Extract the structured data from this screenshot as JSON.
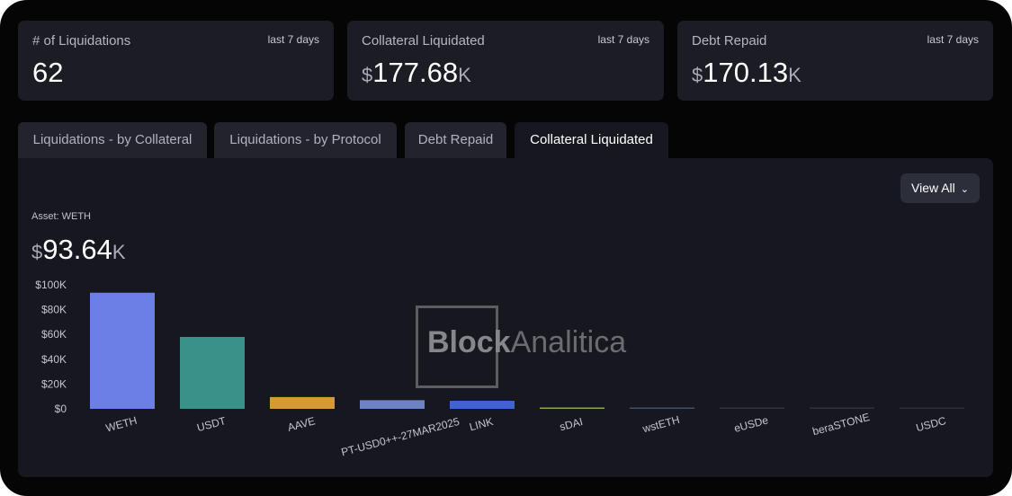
{
  "cards": [
    {
      "label": "# of Liquidations",
      "period": "last 7 days",
      "currency": "",
      "number": "62",
      "suffix": ""
    },
    {
      "label": "Collateral Liquidated",
      "period": "last 7 days",
      "currency": "$",
      "number": "177.68",
      "suffix": "K"
    },
    {
      "label": "Debt Repaid",
      "period": "last 7 days",
      "currency": "$",
      "number": "170.13",
      "suffix": "K"
    }
  ],
  "tabs": [
    {
      "label": "Liquidations - by Collateral",
      "active": false
    },
    {
      "label": "Liquidations - by Protocol",
      "active": false
    },
    {
      "label": "Debt Repaid",
      "active": false
    },
    {
      "label": "Collateral Liquidated",
      "active": true
    }
  ],
  "view_all": "View All",
  "asset_label": "Asset: WETH",
  "selected_value": {
    "currency": "$",
    "number": "93.64",
    "suffix": "K"
  },
  "watermark": {
    "bold": "Block",
    "light": "Analitica"
  },
  "chart_data": {
    "type": "bar",
    "categories": [
      "WETH",
      "USDT",
      "AAVE",
      "PT-USD0++-27MAR2025",
      "LINK",
      "sDAI",
      "wstETH",
      "eUSDe",
      "beraSTONE",
      "USDC"
    ],
    "values": [
      93.64,
      58,
      9.5,
      7,
      6.5,
      1,
      0.5,
      0.2,
      0.1,
      0.05
    ],
    "colors": [
      "#6b7fe6",
      "#3a9189",
      "#d69a34",
      "#6e83c6",
      "#3f63d6",
      "#8da84a",
      "#3c5070",
      "#303344",
      "#2d303e",
      "#2b2e3c"
    ],
    "ytick_labels": [
      "$0",
      "$20K",
      "$40K",
      "$60K",
      "$80K",
      "$100K"
    ],
    "yticks": [
      0,
      20,
      40,
      60,
      80,
      100
    ],
    "ylim": [
      0,
      100
    ],
    "unit": "K USD",
    "grid": false,
    "legend": "none"
  }
}
